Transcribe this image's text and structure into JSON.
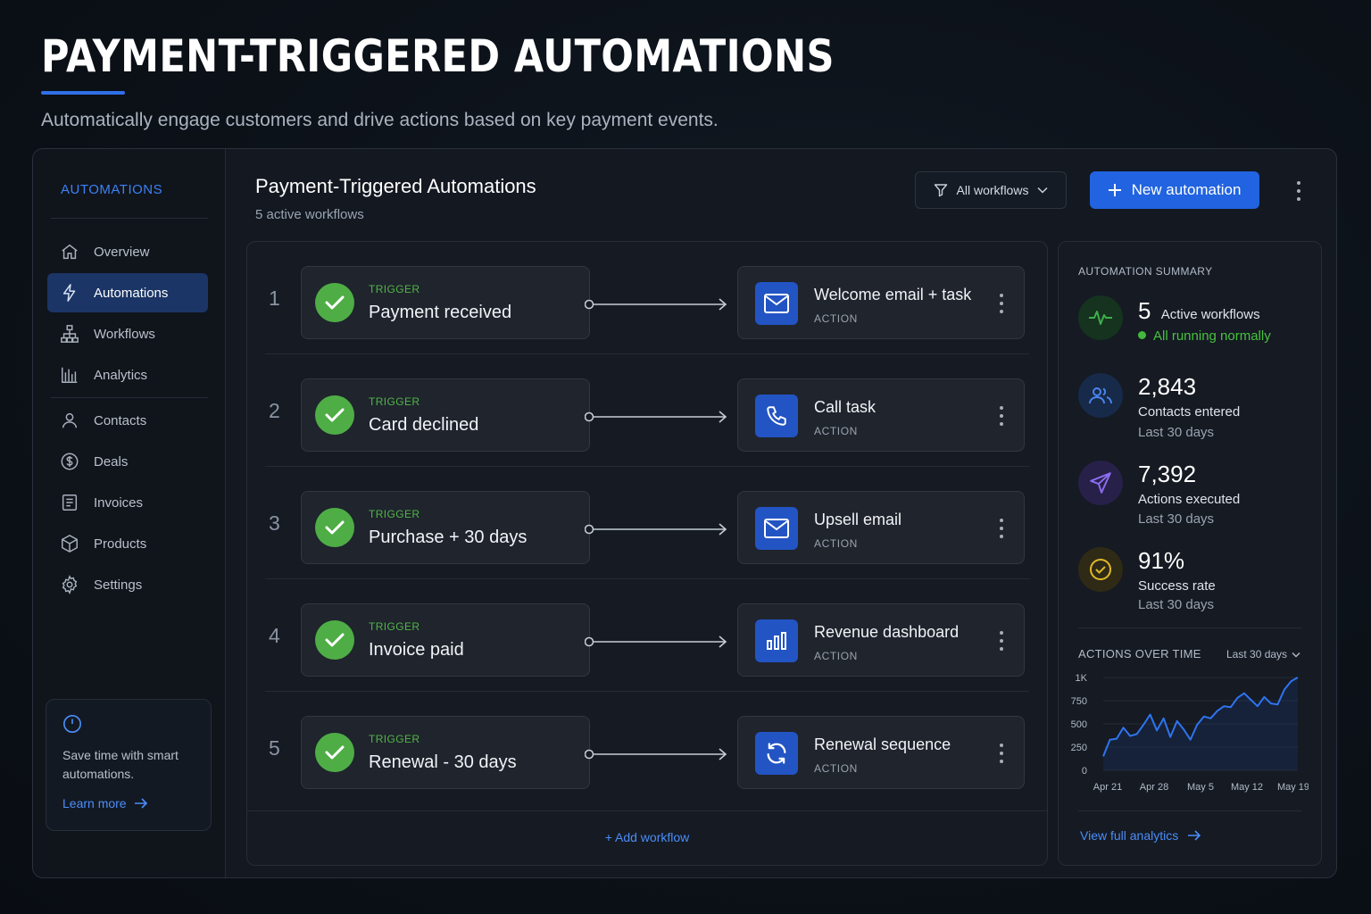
{
  "hero": {
    "title": "PAYMENT-TRIGGERED AUTOMATIONS",
    "subtitle": "Automatically engage customers and drive actions based on key payment events."
  },
  "sidebar": {
    "heading": "AUTOMATIONS",
    "items": [
      {
        "label": "Overview",
        "icon": "home-icon",
        "active": false
      },
      {
        "label": "Automations",
        "icon": "lightning-icon",
        "active": true
      },
      {
        "label": "Workflows",
        "icon": "sitemap-icon",
        "active": false
      },
      {
        "label": "Analytics",
        "icon": "bar-chart-icon",
        "active": false
      },
      {
        "label": "Contacts",
        "icon": "user-icon",
        "active": false
      },
      {
        "label": "Deals",
        "icon": "dollar-icon",
        "active": false
      },
      {
        "label": "Invoices",
        "icon": "document-icon",
        "active": false
      },
      {
        "label": "Products",
        "icon": "box-icon",
        "active": false
      },
      {
        "label": "Settings",
        "icon": "gear-icon",
        "active": false
      }
    ],
    "promo": {
      "text": "Save time with smart automations.",
      "link": "Learn more"
    }
  },
  "header": {
    "title": "Payment-Triggered Automations",
    "subtitle": "5 active workflows",
    "filter_label": "All workflows",
    "new_button_label": "New automation"
  },
  "workflows": [
    {
      "number": "1",
      "trigger_label": "TRIGGER",
      "trigger": "Payment received",
      "action": "Welcome email + task",
      "action_label": "ACTION",
      "action_icon": "mail-icon"
    },
    {
      "number": "2",
      "trigger_label": "TRIGGER",
      "trigger": "Card declined",
      "action": "Call task",
      "action_label": "ACTION",
      "action_icon": "phone-icon"
    },
    {
      "number": "3",
      "trigger_label": "TRIGGER",
      "trigger": "Purchase + 30 days",
      "action": "Upsell email",
      "action_label": "ACTION",
      "action_icon": "mail-icon"
    },
    {
      "number": "4",
      "trigger_label": "TRIGGER",
      "trigger": "Invoice paid",
      "action": "Revenue dashboard",
      "action_label": "ACTION",
      "action_icon": "bar-chart-icon"
    },
    {
      "number": "5",
      "trigger_label": "TRIGGER",
      "trigger": "Renewal - 30 days",
      "action": "Renewal sequence",
      "action_label": "ACTION",
      "action_icon": "refresh-icon"
    }
  ],
  "add_workflow_label": "+ Add workflow",
  "summary": {
    "heading": "AUTOMATION SUMMARY",
    "active": {
      "value": "5",
      "label": "Active workflows",
      "status": "All running normally"
    },
    "contacts": {
      "value": "2,843",
      "label": "Contacts entered",
      "period": "Last 30 days"
    },
    "actions": {
      "value": "7,392",
      "label": "Actions executed",
      "period": "Last 30 days"
    },
    "success": {
      "value": "91%",
      "label": "Success rate",
      "period": "Last 30 days"
    },
    "chart_title": "ACTIONS OVER TIME",
    "chart_range": "Last 30 days",
    "view_link": "View full analytics"
  },
  "colors": {
    "accent": "#2163e0",
    "trigger_green": "#52b447",
    "activity_green": "#3fae4a",
    "people_blue": "#4a86f0",
    "send_purple": "#8b6df0",
    "success_yellow": "#e0b92a"
  },
  "chart_data": {
    "type": "area",
    "title": "ACTIONS OVER TIME",
    "x_tick_labels": [
      "Apr 21",
      "Apr 28",
      "May 5",
      "May 12",
      "May 19"
    ],
    "y_tick_labels": [
      "0",
      "250",
      "500",
      "750",
      "1K"
    ],
    "ylim": [
      0,
      1000
    ],
    "grid": true,
    "series": [
      {
        "values": [
          150,
          330,
          340,
          460,
          370,
          390,
          490,
          600,
          430,
          560,
          360,
          530,
          440,
          330,
          490,
          580,
          560,
          640,
          690,
          680,
          780,
          830,
          760,
          690,
          790,
          720,
          710,
          870,
          960,
          1000
        ]
      }
    ]
  }
}
